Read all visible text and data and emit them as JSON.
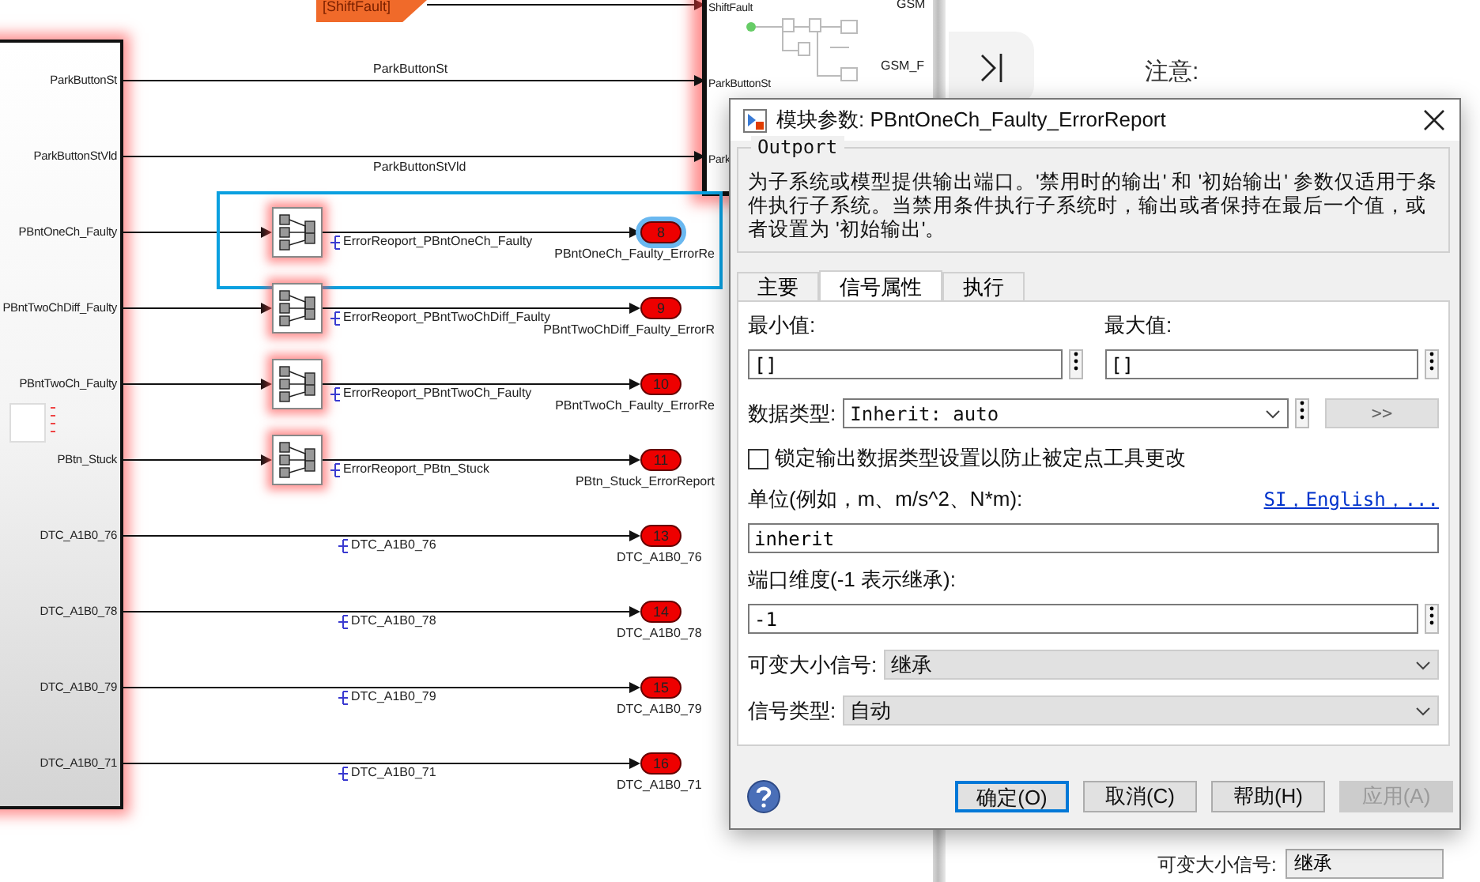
{
  "canvas": {
    "goto_tag": "[ShiftFault]",
    "subsystem": {
      "ports": [
        "ParkButtonSt",
        "ParkButtonStVld",
        "PBntOneCh_Faulty",
        "PBntTwoChDiff_Faulty",
        "PBntTwoCh_Faulty",
        "PBtn_Stuck",
        "DTC_A1B0_76",
        "DTC_A1B0_78",
        "DTC_A1B0_79",
        "DTC_A1B0_71"
      ]
    },
    "target_subsystem": {
      "ports": [
        "ShiftFault",
        "ParkButtonSt",
        "Park"
      ],
      "internal_labels": [
        "GSM",
        "GSM_F"
      ]
    },
    "signals": [
      {
        "kind": "through",
        "line_label": "ParkButtonSt",
        "selected": false
      },
      {
        "kind": "through",
        "line_label": "ParkButtonStVld",
        "selected": false
      },
      {
        "kind": "bus",
        "line_label": "ErrorReoport_PBntOneCh_Faulty",
        "outport_number": "8",
        "outport_name": "PBntOneCh_Faulty_ErrorRe",
        "selected": true
      },
      {
        "kind": "bus",
        "line_label": "ErrorReoport_PBntTwoChDiff_Faulty",
        "outport_number": "9",
        "outport_name": "PBntTwoChDiff_Faulty_ErrorR",
        "selected": false
      },
      {
        "kind": "bus",
        "line_label": "ErrorReoport_PBntTwoCh_Faulty",
        "outport_number": "10",
        "outport_name": "PBntTwoCh_Faulty_ErrorRe",
        "selected": false
      },
      {
        "kind": "bus",
        "line_label": "ErrorReoport_PBtn_Stuck",
        "outport_number": "11",
        "outport_name": "PBtn_Stuck_ErrorReport",
        "selected": false
      },
      {
        "kind": "direct",
        "line_label": "DTC_A1B0_76",
        "outport_number": "13",
        "outport_name": "DTC_A1B0_76",
        "selected": false
      },
      {
        "kind": "direct",
        "line_label": "DTC_A1B0_78",
        "outport_number": "14",
        "outport_name": "DTC_A1B0_78",
        "selected": false
      },
      {
        "kind": "direct",
        "line_label": "DTC_A1B0_79",
        "outport_number": "15",
        "outport_name": "DTC_A1B0_79",
        "selected": false
      },
      {
        "kind": "direct",
        "line_label": "DTC_A1B0_71",
        "outport_number": "16",
        "outport_name": "DTC_A1B0_71",
        "selected": false
      }
    ]
  },
  "side_panel": {
    "note_label": "注意:",
    "bottom_field": {
      "label": "可变大小信号:",
      "value": "继承"
    }
  },
  "dialog": {
    "title": "模块参数: PBntOneCh_Faulty_ErrorReport",
    "group": "Outport",
    "description": "为子系统或模型提供输出端口。'禁用时的输出' 和 '初始输出' 参数仅适用于条件执行子系统。当禁用条件执行子系统时，输出或者保持在最后一个值，或者设置为 '初始输出'。",
    "tabs": [
      {
        "label": "主要",
        "selected": false
      },
      {
        "label": "信号属性",
        "selected": true
      },
      {
        "label": "执行",
        "selected": false
      }
    ],
    "min": {
      "label": "最小值:",
      "value": "[]"
    },
    "max": {
      "label": "最大值:",
      "value": "[]"
    },
    "data_type": {
      "label": "数据类型:",
      "value": "Inherit: auto",
      "button": ">>"
    },
    "lock": {
      "label": "锁定输出数据类型设置以防止被定点工具更改",
      "checked": false
    },
    "unit": {
      "label": "单位(例如，m、m/s^2、N*m):",
      "link": "SI，English，...",
      "value": "inherit"
    },
    "dimensions": {
      "label": "端口维度(-1 表示继承):",
      "value": "-1"
    },
    "variable_size": {
      "label": "可变大小信号:",
      "value": "继承"
    },
    "signal_type": {
      "label": "信号类型:",
      "value": "自动"
    },
    "buttons": [
      {
        "label": "确定(O)",
        "default": true,
        "disabled": false
      },
      {
        "label": "取消(C)",
        "default": false,
        "disabled": false
      },
      {
        "label": "帮助(H)",
        "default": false,
        "disabled": false
      },
      {
        "label": "应用(A)",
        "default": false,
        "disabled": true
      }
    ]
  }
}
